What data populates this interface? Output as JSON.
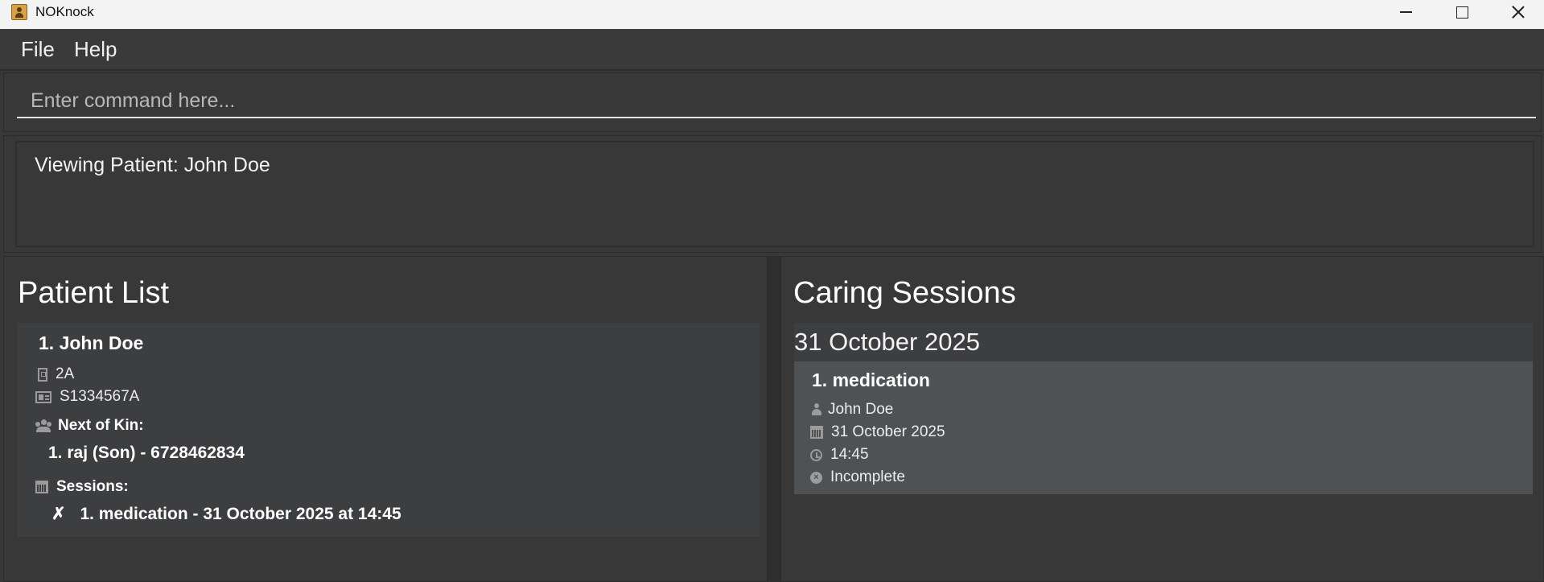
{
  "window": {
    "title": "NOKnock"
  },
  "menu": {
    "file": "File",
    "help": "Help"
  },
  "command": {
    "placeholder": "Enter command here..."
  },
  "result": {
    "text": "Viewing Patient: John Doe"
  },
  "patient_list": {
    "heading": "Patient List",
    "patients": [
      {
        "title": "1. John Doe",
        "ward": "2A",
        "ic": "S1334567A",
        "kin_heading": "Next of Kin:",
        "kin": [
          "1. raj (Son) - 6728462834"
        ],
        "sessions_heading": "Sessions:",
        "sessions": [
          {
            "status_mark": "✗",
            "text": "1. medication - 31 October 2025 at 14:45"
          }
        ]
      }
    ]
  },
  "caring_sessions": {
    "heading": "Caring Sessions",
    "groups": [
      {
        "date": "31 October 2025",
        "sessions": [
          {
            "title": "1. medication",
            "patient": "John Doe",
            "date": "31 October 2025",
            "time": "14:45",
            "status": "Incomplete"
          }
        ]
      }
    ]
  },
  "icons": {
    "ward": "building-icon",
    "ic": "id-card-icon",
    "kin": "users-icon",
    "sessions": "calendar-icon",
    "patient": "person-icon",
    "date": "calendar-icon",
    "time": "clock-icon",
    "status": "x-circle-icon"
  },
  "colors": {
    "background": "#383838",
    "card": "#3d3e40",
    "selected_card": "#4f5255",
    "titlebar": "#f3f3f3"
  }
}
